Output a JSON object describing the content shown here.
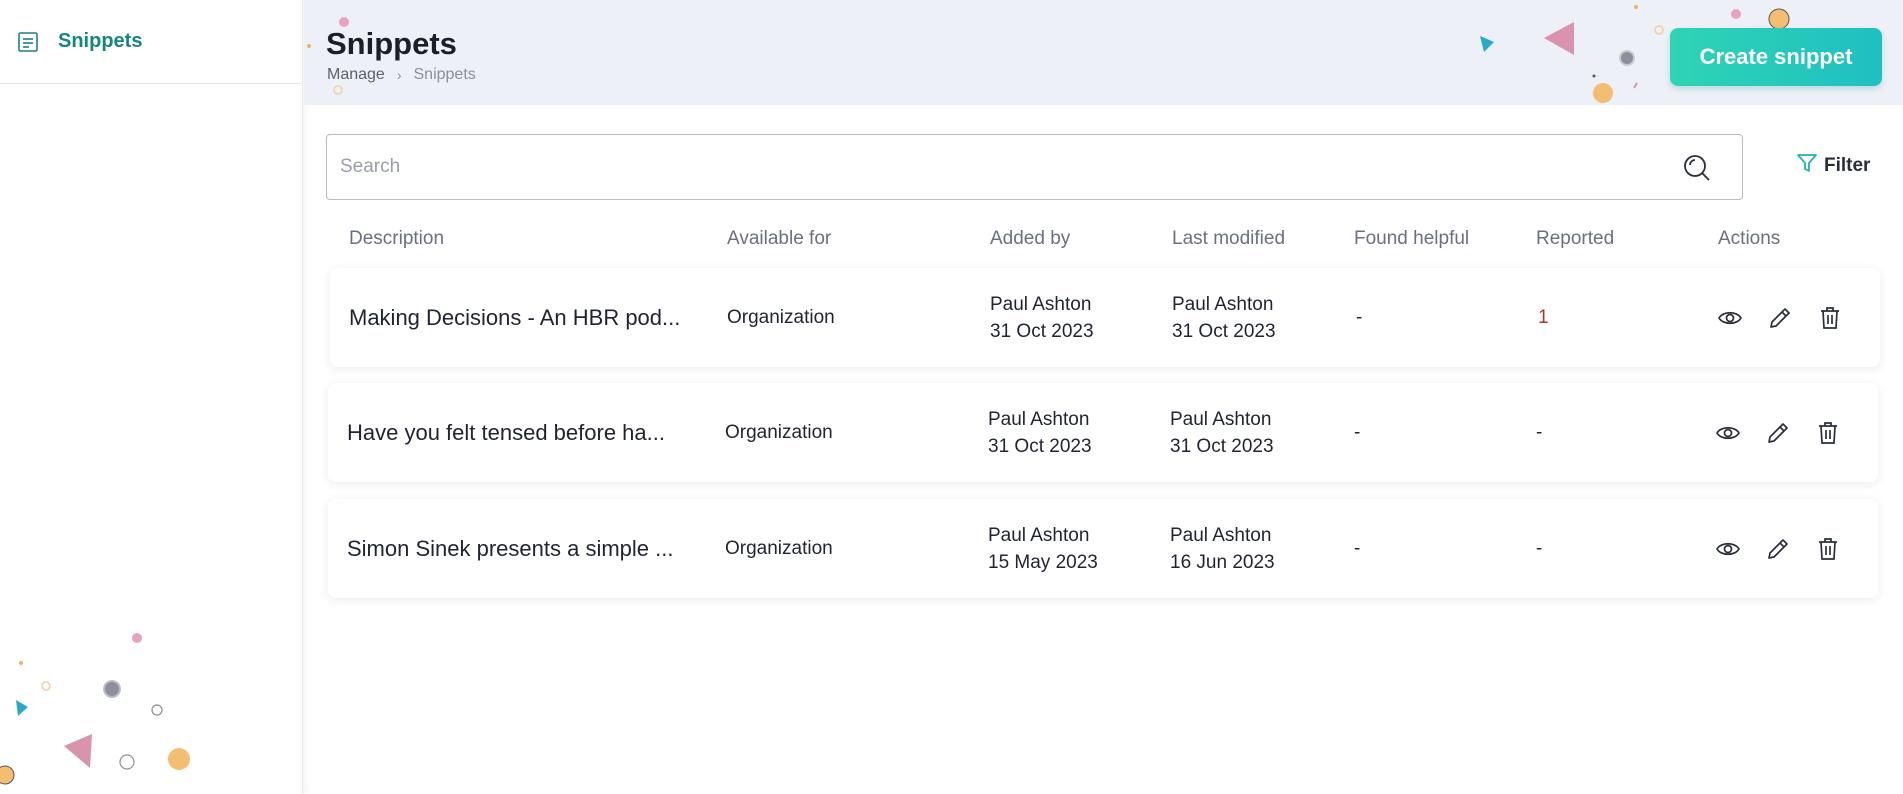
{
  "sidebar": {
    "items": [
      {
        "label": "Snippets",
        "icon": "document-list-icon",
        "active": true
      }
    ]
  },
  "header": {
    "title": "Snippets",
    "breadcrumb": {
      "parent": "Manage",
      "separator": "›",
      "current": "Snippets"
    },
    "create_button": "Create snippet"
  },
  "search": {
    "placeholder": "Search",
    "value": ""
  },
  "filter": {
    "label": "Filter"
  },
  "table": {
    "columns": [
      "Description",
      "Available for",
      "Added by",
      "Last modified",
      "Found helpful",
      "Reported",
      "Actions"
    ],
    "rows": [
      {
        "description": "Making Decisions - An HBR pod...",
        "available_for": "Organization",
        "added_by": {
          "name": "Paul Ashton",
          "date": "31 Oct 2023"
        },
        "last_modified": {
          "name": "Paul Ashton",
          "date": "31 Oct 2023"
        },
        "found_helpful": "-",
        "reported": "1"
      },
      {
        "description": "Have you felt tensed before ha...",
        "available_for": "Organization",
        "added_by": {
          "name": "Paul Ashton",
          "date": "31 Oct 2023"
        },
        "last_modified": {
          "name": "Paul Ashton",
          "date": "31 Oct 2023"
        },
        "found_helpful": "-",
        "reported": "-"
      },
      {
        "description": "Simon Sinek presents a simple ...",
        "available_for": "Organization",
        "added_by": {
          "name": "Paul Ashton",
          "date": "15 May 2023"
        },
        "last_modified": {
          "name": "Paul Ashton",
          "date": "16 Jun 2023"
        },
        "found_helpful": "-",
        "reported": "-"
      }
    ]
  },
  "colors": {
    "accent": "#16867c",
    "button_gradient_start": "#2fd4b4",
    "button_gradient_end": "#1fbfc2",
    "header_bg": "#eef0f7",
    "reported_highlight": "#9b3f2d"
  }
}
